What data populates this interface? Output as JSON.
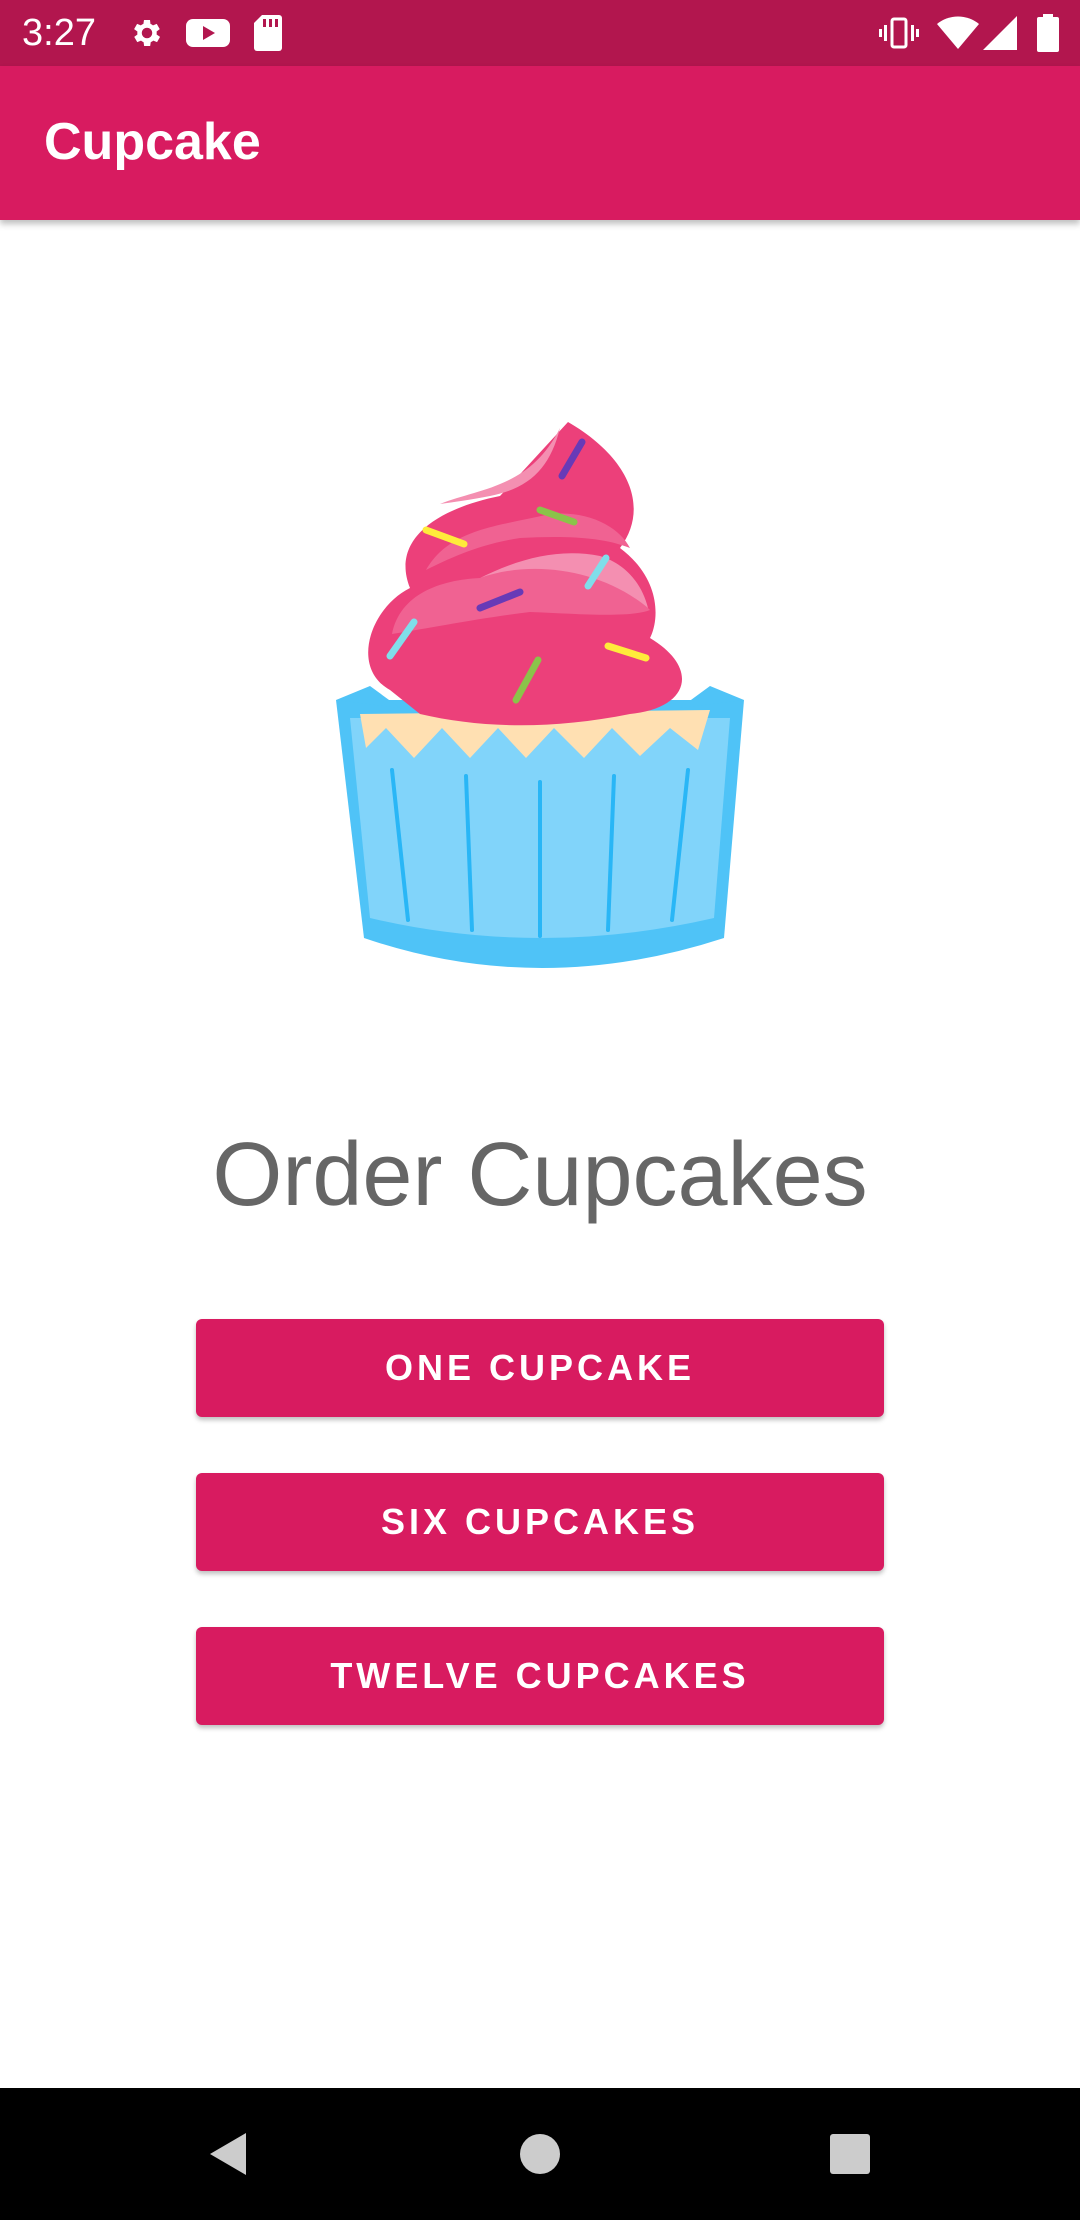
{
  "status_bar": {
    "time": "3:27",
    "icons_left": [
      "gear-icon",
      "youtube-icon",
      "sd-card-icon"
    ],
    "icons_right": [
      "vibrate-icon",
      "wifi-icon",
      "signal-icon",
      "battery-icon"
    ]
  },
  "app_bar": {
    "title": "Cupcake"
  },
  "main": {
    "image": "cupcake-illustration",
    "heading": "Order Cupcakes",
    "buttons": [
      {
        "label": "ONE CUPCAKE"
      },
      {
        "label": "SIX CUPCAKES"
      },
      {
        "label": "TWELVE CUPCAKES"
      }
    ]
  },
  "nav_bar": {
    "buttons": [
      "back-icon",
      "home-icon",
      "recents-icon"
    ]
  },
  "colors": {
    "status_bar": "#b2164e",
    "primary": "#d81b60",
    "heading_text": "#666666",
    "nav_bar": "#000000"
  }
}
